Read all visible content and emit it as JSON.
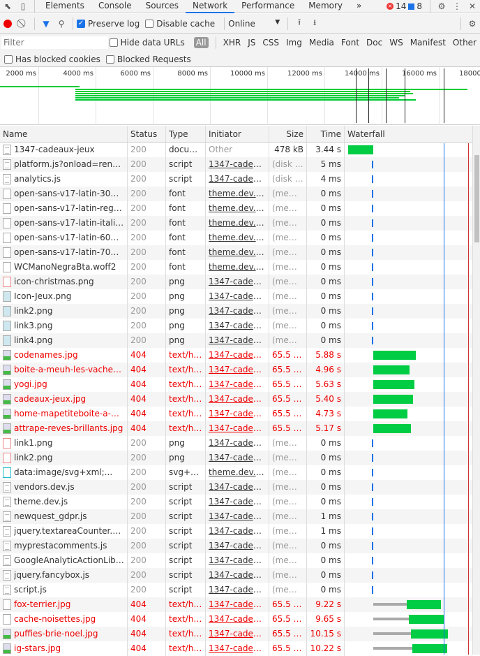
{
  "tabs": [
    "Elements",
    "Console",
    "Sources",
    "Network",
    "Performance",
    "Memory"
  ],
  "active_tab": "Network",
  "more": "»",
  "errors": "14",
  "messages": "8",
  "toolbar": {
    "preserve_log": "Preserve log",
    "preserve_checked": true,
    "disable_cache": "Disable cache",
    "disable_checked": false,
    "throttle": "Online"
  },
  "filter": {
    "placeholder": "Filter",
    "hide_data_urls": "Hide data URLs",
    "types": [
      "All",
      "XHR",
      "JS",
      "CSS",
      "Img",
      "Media",
      "Font",
      "Doc",
      "WS",
      "Manifest",
      "Other"
    ],
    "has_blocked_cookies": "Has blocked cookies",
    "blocked_requests": "Blocked Requests"
  },
  "overview": {
    "ticks": [
      "2000 ms",
      "4000 ms",
      "6000 ms",
      "8000 ms",
      "10000 ms",
      "12000 ms",
      "14000 ms",
      "16000 ms",
      "18000 ms"
    ]
  },
  "colors": {
    "error": "#e00000",
    "green": "#00cc44",
    "blue": "#1a73e8",
    "red": "#cc3333"
  },
  "columns": [
    "Name",
    "Status",
    "Type",
    "Initiator",
    "Size",
    "Time",
    "Waterfall"
  ],
  "rows": [
    {
      "name": "1347-cadeaux-jeux",
      "status": "200",
      "type": "docum...",
      "initiator": "Other",
      "size": "478 kB",
      "time": "3.44 s",
      "icon": "doc",
      "wf": [
        0,
        0,
        3.44
      ]
    },
    {
      "name": "platform.js?onload=renderB...",
      "status": "200",
      "type": "script",
      "initiator": "1347-cadeau...",
      "size": "(disk c...",
      "time": "5 ms",
      "icon": "doc",
      "wf": [
        3.25,
        0,
        0
      ]
    },
    {
      "name": "analytics.js",
      "status": "200",
      "type": "script",
      "initiator": "1347-cadeau...",
      "size": "(disk c...",
      "time": "4 ms",
      "icon": "doc",
      "wf": [
        3.25,
        0,
        0
      ]
    },
    {
      "name": "open-sans-v17-latin-300.w...",
      "status": "200",
      "type": "font",
      "initiator": "theme.dev.cs...",
      "size": "(mem...",
      "time": "0 ms",
      "icon": "blank",
      "wf": [
        3.25,
        0,
        0
      ]
    },
    {
      "name": "open-sans-v17-latin-regula...",
      "status": "200",
      "type": "font",
      "initiator": "theme.dev.cs...",
      "size": "(mem...",
      "time": "0 ms",
      "icon": "blank",
      "wf": [
        3.25,
        0,
        0
      ]
    },
    {
      "name": "open-sans-v17-latin-italic.w...",
      "status": "200",
      "type": "font",
      "initiator": "theme.dev.cs...",
      "size": "(mem...",
      "time": "0 ms",
      "icon": "blank",
      "wf": [
        3.25,
        0,
        0
      ]
    },
    {
      "name": "open-sans-v17-latin-600.w...",
      "status": "200",
      "type": "font",
      "initiator": "theme.dev.cs...",
      "size": "(mem...",
      "time": "0 ms",
      "icon": "blank",
      "wf": [
        3.25,
        0,
        0
      ]
    },
    {
      "name": "open-sans-v17-latin-700.w...",
      "status": "200",
      "type": "font",
      "initiator": "theme.dev.cs...",
      "size": "(mem...",
      "time": "0 ms",
      "icon": "blank",
      "wf": [
        3.25,
        0,
        0
      ]
    },
    {
      "name": "WCManoNegraBta.woff2",
      "status": "200",
      "type": "font",
      "initiator": "theme.dev.cs...",
      "size": "(mem...",
      "time": "0 ms",
      "icon": "blank",
      "wf": [
        3.25,
        0,
        0
      ]
    },
    {
      "name": "icon-christmas.png",
      "status": "200",
      "type": "png",
      "initiator": "1347-cadeau...",
      "size": "(mem...",
      "time": "0 ms",
      "icon": "red",
      "wf": [
        3.25,
        0,
        0
      ]
    },
    {
      "name": "Icon-Jeux.png",
      "status": "200",
      "type": "png",
      "initiator": "1347-cadeau...",
      "size": "(mem...",
      "time": "0 ms",
      "icon": "img",
      "wf": [
        3.25,
        0,
        0
      ]
    },
    {
      "name": "link2.png",
      "status": "200",
      "type": "png",
      "initiator": "1347-cadeau...",
      "size": "(mem...",
      "time": "0 ms",
      "icon": "img",
      "wf": [
        3.25,
        0,
        0
      ]
    },
    {
      "name": "link3.png",
      "status": "200",
      "type": "png",
      "initiator": "1347-cadeau...",
      "size": "(mem...",
      "time": "0 ms",
      "icon": "img",
      "wf": [
        3.25,
        0,
        0
      ]
    },
    {
      "name": "link4.png",
      "status": "200",
      "type": "png",
      "initiator": "1347-cadeau...",
      "size": "(mem...",
      "time": "0 ms",
      "icon": "img",
      "wf": [
        3.25,
        0,
        0
      ]
    },
    {
      "name": "codenames.jpg",
      "status": "404",
      "type": "text/ht...",
      "initiator": "1347-cadeau...",
      "size": "65.5 kB",
      "time": "5.88 s",
      "icon": "img404",
      "error": true,
      "wf": [
        3.44,
        0,
        5.8
      ]
    },
    {
      "name": "boite-a-meuh-les-vaches-d...",
      "status": "404",
      "type": "text/ht...",
      "initiator": "1347-cadeau...",
      "size": "65.5 kB",
      "time": "4.96 s",
      "icon": "img404",
      "error": true,
      "wf": [
        3.44,
        0,
        4.9
      ]
    },
    {
      "name": "yogi.jpg",
      "status": "404",
      "type": "text/ht...",
      "initiator": "1347-cadeau...",
      "size": "65.5 kB",
      "time": "5.63 s",
      "icon": "img404",
      "error": true,
      "wf": [
        3.44,
        0,
        5.6
      ]
    },
    {
      "name": "cadeaux-jeux.jpg",
      "status": "404",
      "type": "text/ht...",
      "initiator": "1347-cadeau...",
      "size": "65.5 kB",
      "time": "5.40 s",
      "icon": "img404",
      "error": true,
      "wf": [
        3.44,
        0,
        5.4
      ]
    },
    {
      "name": "home-mapetiteboite-a-den...",
      "status": "404",
      "type": "text/ht...",
      "initiator": "1347-cadeau...",
      "size": "65.5 kB",
      "time": "4.73 s",
      "icon": "img404",
      "error": true,
      "wf": [
        3.44,
        0,
        4.7
      ]
    },
    {
      "name": "attrape-reves-brillants.jpg",
      "status": "404",
      "type": "text/ht...",
      "initiator": "1347-cadeau...",
      "size": "65.5 kB",
      "time": "5.17 s",
      "icon": "img404",
      "error": true,
      "wf": [
        3.44,
        0,
        5.1
      ]
    },
    {
      "name": "link1.png",
      "status": "200",
      "type": "png",
      "initiator": "1347-cadeau...",
      "size": "(mem...",
      "time": "0 ms",
      "icon": "red",
      "wf": [
        3.25,
        0,
        0
      ]
    },
    {
      "name": "link2.png",
      "status": "200",
      "type": "png",
      "initiator": "1347-cadeau...",
      "size": "(mem...",
      "time": "0 ms",
      "icon": "red",
      "wf": [
        3.25,
        0,
        0
      ]
    },
    {
      "name": "data:image/svg+xml;...",
      "status": "200",
      "type": "svg+xml",
      "initiator": "theme.dev.css",
      "size": "(mem...",
      "time": "0 ms",
      "icon": "svg",
      "wf": [
        3.25,
        0,
        0
      ]
    },
    {
      "name": "vendors.dev.js",
      "status": "200",
      "type": "script",
      "initiator": "1347-cadeau...",
      "size": "(mem...",
      "time": "0 ms",
      "icon": "doc",
      "wf": [
        3.25,
        0,
        0
      ]
    },
    {
      "name": "theme.dev.js",
      "status": "200",
      "type": "script",
      "initiator": "1347-cadeau...",
      "size": "(mem...",
      "time": "0 ms",
      "icon": "doc",
      "wf": [
        3.25,
        0,
        0
      ]
    },
    {
      "name": "newquest_gdpr.js",
      "status": "200",
      "type": "script",
      "initiator": "1347-cadeau...",
      "size": "(mem...",
      "time": "1 ms",
      "icon": "doc",
      "wf": [
        3.25,
        0,
        0
      ]
    },
    {
      "name": "jquery.textareaCounter.plug...",
      "status": "200",
      "type": "script",
      "initiator": "1347-cadeau...",
      "size": "(mem...",
      "time": "1 ms",
      "icon": "doc",
      "wf": [
        3.25,
        0,
        0
      ]
    },
    {
      "name": "myprestacomments.js",
      "status": "200",
      "type": "script",
      "initiator": "1347-cadeau...",
      "size": "(mem...",
      "time": "0 ms",
      "icon": "doc",
      "wf": [
        3.25,
        0,
        0
      ]
    },
    {
      "name": "GoogleAnalyticActionLib.js",
      "status": "200",
      "type": "script",
      "initiator": "1347-cadeau...",
      "size": "(mem...",
      "time": "0 ms",
      "icon": "doc",
      "wf": [
        3.25,
        0,
        0
      ]
    },
    {
      "name": "jquery.fancybox.js",
      "status": "200",
      "type": "script",
      "initiator": "1347-cadeau...",
      "size": "(mem...",
      "time": "0 ms",
      "icon": "doc",
      "wf": [
        3.25,
        0,
        0
      ]
    },
    {
      "name": "script.js",
      "status": "200",
      "type": "script",
      "initiator": "1347-cadeau...",
      "size": "(mem...",
      "time": "0 ms",
      "icon": "doc",
      "wf": [
        3.25,
        0,
        0
      ]
    },
    {
      "name": "fox-terrier.jpg",
      "status": "404",
      "type": "text/ht...",
      "initiator": "1347-cadeau...",
      "size": "65.5 kB",
      "time": "9.22 s",
      "icon": "blank",
      "error": true,
      "wf": [
        3.44,
        4.6,
        4.6
      ]
    },
    {
      "name": "cache-noisettes.jpg",
      "status": "404",
      "type": "text/ht...",
      "initiator": "1347-cadeau...",
      "size": "65.5 kB",
      "time": "9.65 s",
      "icon": "blank",
      "error": true,
      "wf": [
        3.44,
        4.8,
        4.8
      ]
    },
    {
      "name": "puffies-brie-noel.jpg",
      "status": "404",
      "type": "text/ht...",
      "initiator": "1347-cadeau...",
      "size": "65.5 kB",
      "time": "10.15 s",
      "icon": "img404",
      "error": true,
      "wf": [
        3.44,
        5.1,
        5.1
      ]
    },
    {
      "name": "ig-stars.jpg",
      "status": "404",
      "type": "text/ht...",
      "initiator": "1347-cadeau...",
      "size": "65.5 kB",
      "time": "10.22 s",
      "icon": "img404",
      "error": true,
      "wf": [
        3.44,
        5.3,
        4.8
      ]
    }
  ],
  "waterfall": {
    "dom_content_loaded_s": 13.0,
    "load_s": 16.3
  }
}
